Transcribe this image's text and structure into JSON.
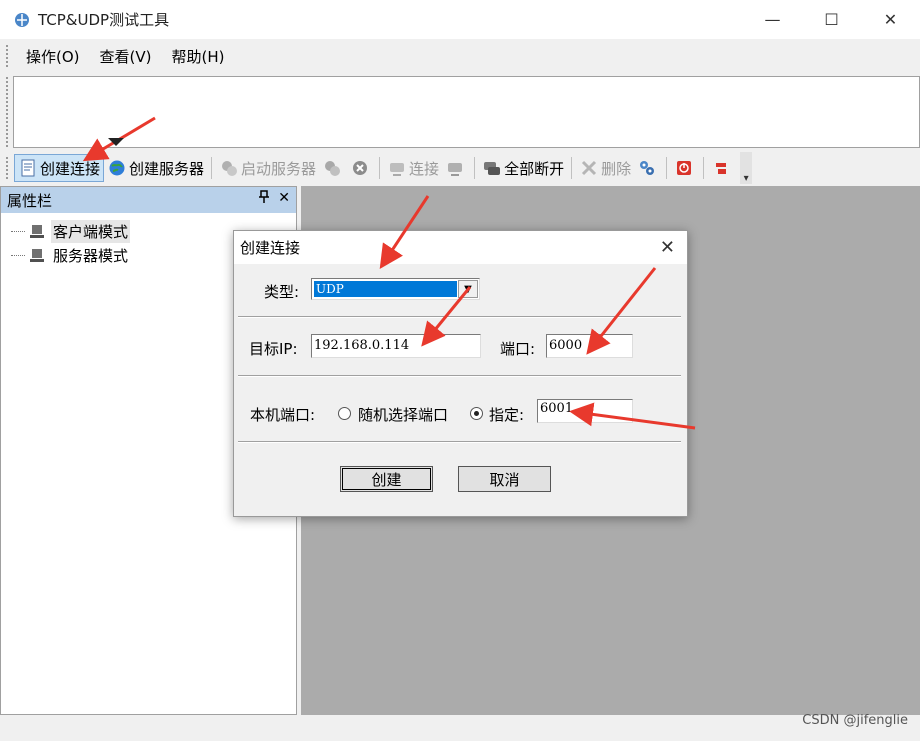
{
  "window": {
    "title": "TCP&UDP测试工具",
    "minimize_glyph": "—",
    "maximize_glyph": "☐",
    "close_glyph": "✕"
  },
  "menu": {
    "items": [
      {
        "label": "操作(O)"
      },
      {
        "label": "查看(V)"
      },
      {
        "label": "帮助(H)"
      }
    ]
  },
  "toolbar": {
    "create_connection": "创建连接",
    "create_server": "创建服务器",
    "start_server": "启动服务器",
    "connect": "连接",
    "disconnect_all": "全部断开",
    "delete": "删除"
  },
  "panel": {
    "title": "属性栏",
    "pin_glyph": "📌",
    "close_glyph": "✕",
    "tree_items": [
      {
        "label": "客户端模式",
        "selected": true
      },
      {
        "label": "服务器模式",
        "selected": false
      }
    ]
  },
  "dialog": {
    "title": "创建连接",
    "type_label": "类型:",
    "type_value": "UDP",
    "target_ip_label": "目标IP:",
    "target_ip_value": "192.168.0.114",
    "port_label": "端口:",
    "port_value": "6000",
    "local_port_label": "本机端口:",
    "random_port_label": "随机选择端口",
    "specified_label": "指定:",
    "specified_port_value": "6001",
    "random_selected": false,
    "specified_selected": true,
    "create_button": "创建",
    "cancel_button": "取消"
  },
  "watermark": "CSDN @jifenglie",
  "colors": {
    "panel_header": "#b9d1ea",
    "selection_blue": "#0078d7",
    "annotation_red": "#e8392d",
    "mdi_gray": "#ababab"
  }
}
